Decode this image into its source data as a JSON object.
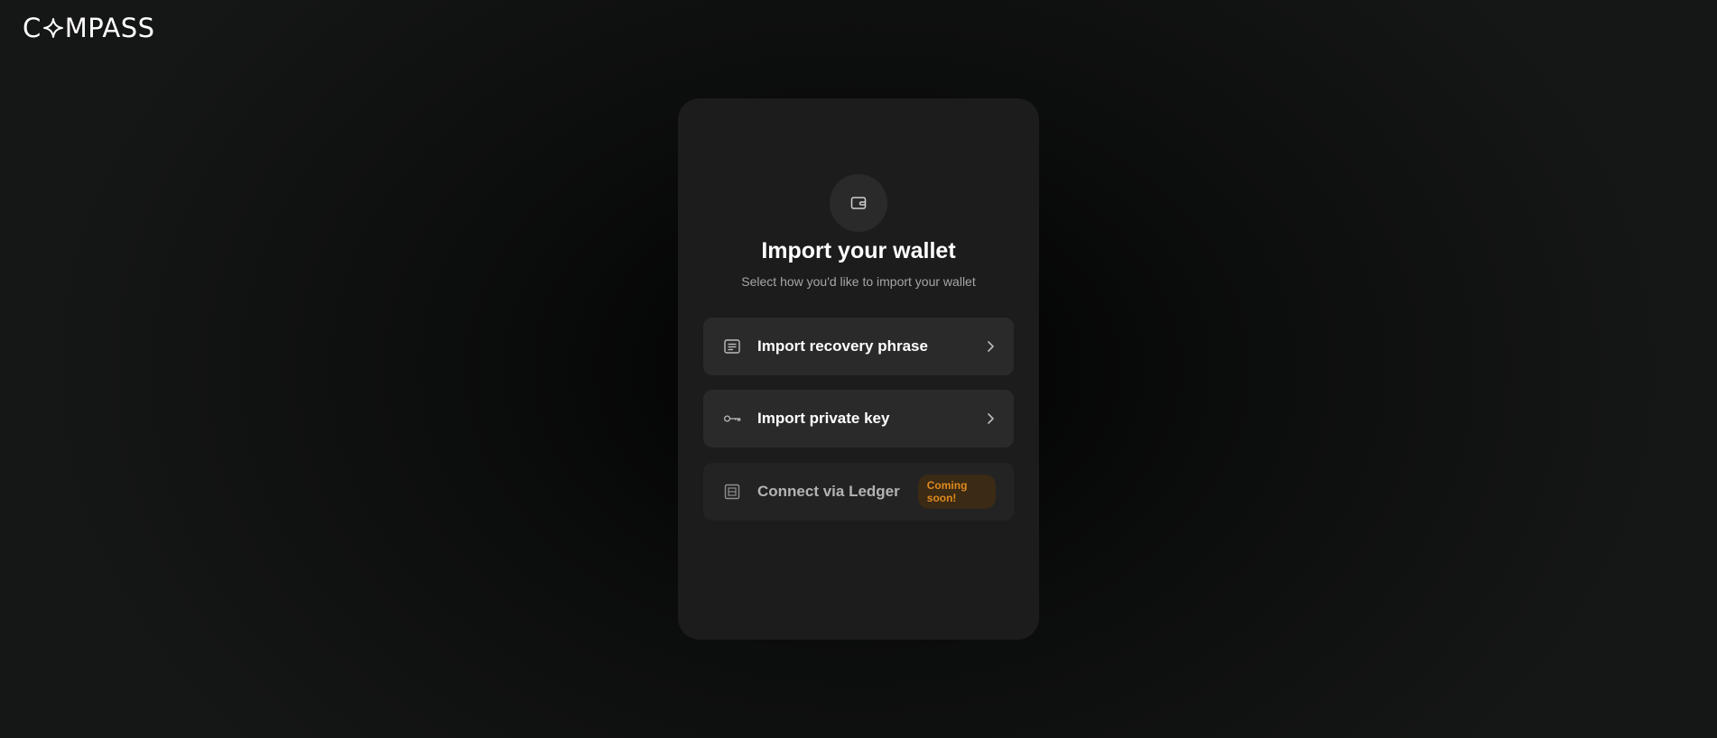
{
  "brand": {
    "logo_prefix": "C",
    "logo_suffix": "MPASS",
    "logo_icon": "compass-star-icon"
  },
  "page": {
    "title": "Import your wallet",
    "subtitle": "Select how you'd like to import your wallet",
    "header_icon": "wallet-icon"
  },
  "options": [
    {
      "label": "Import recovery phrase",
      "icon": "document-lines-icon",
      "enabled": true
    },
    {
      "label": "Import private key",
      "icon": "key-icon",
      "enabled": true
    },
    {
      "label": "Connect via Ledger",
      "icon": "ledger-device-icon",
      "enabled": false,
      "badge": "Coming soon!"
    }
  ],
  "colors": {
    "card_background": "#1c1c1c",
    "option_background": "#2a2a2a",
    "badge_text": "#e08a1e",
    "badge_background": "#3b2a14"
  }
}
